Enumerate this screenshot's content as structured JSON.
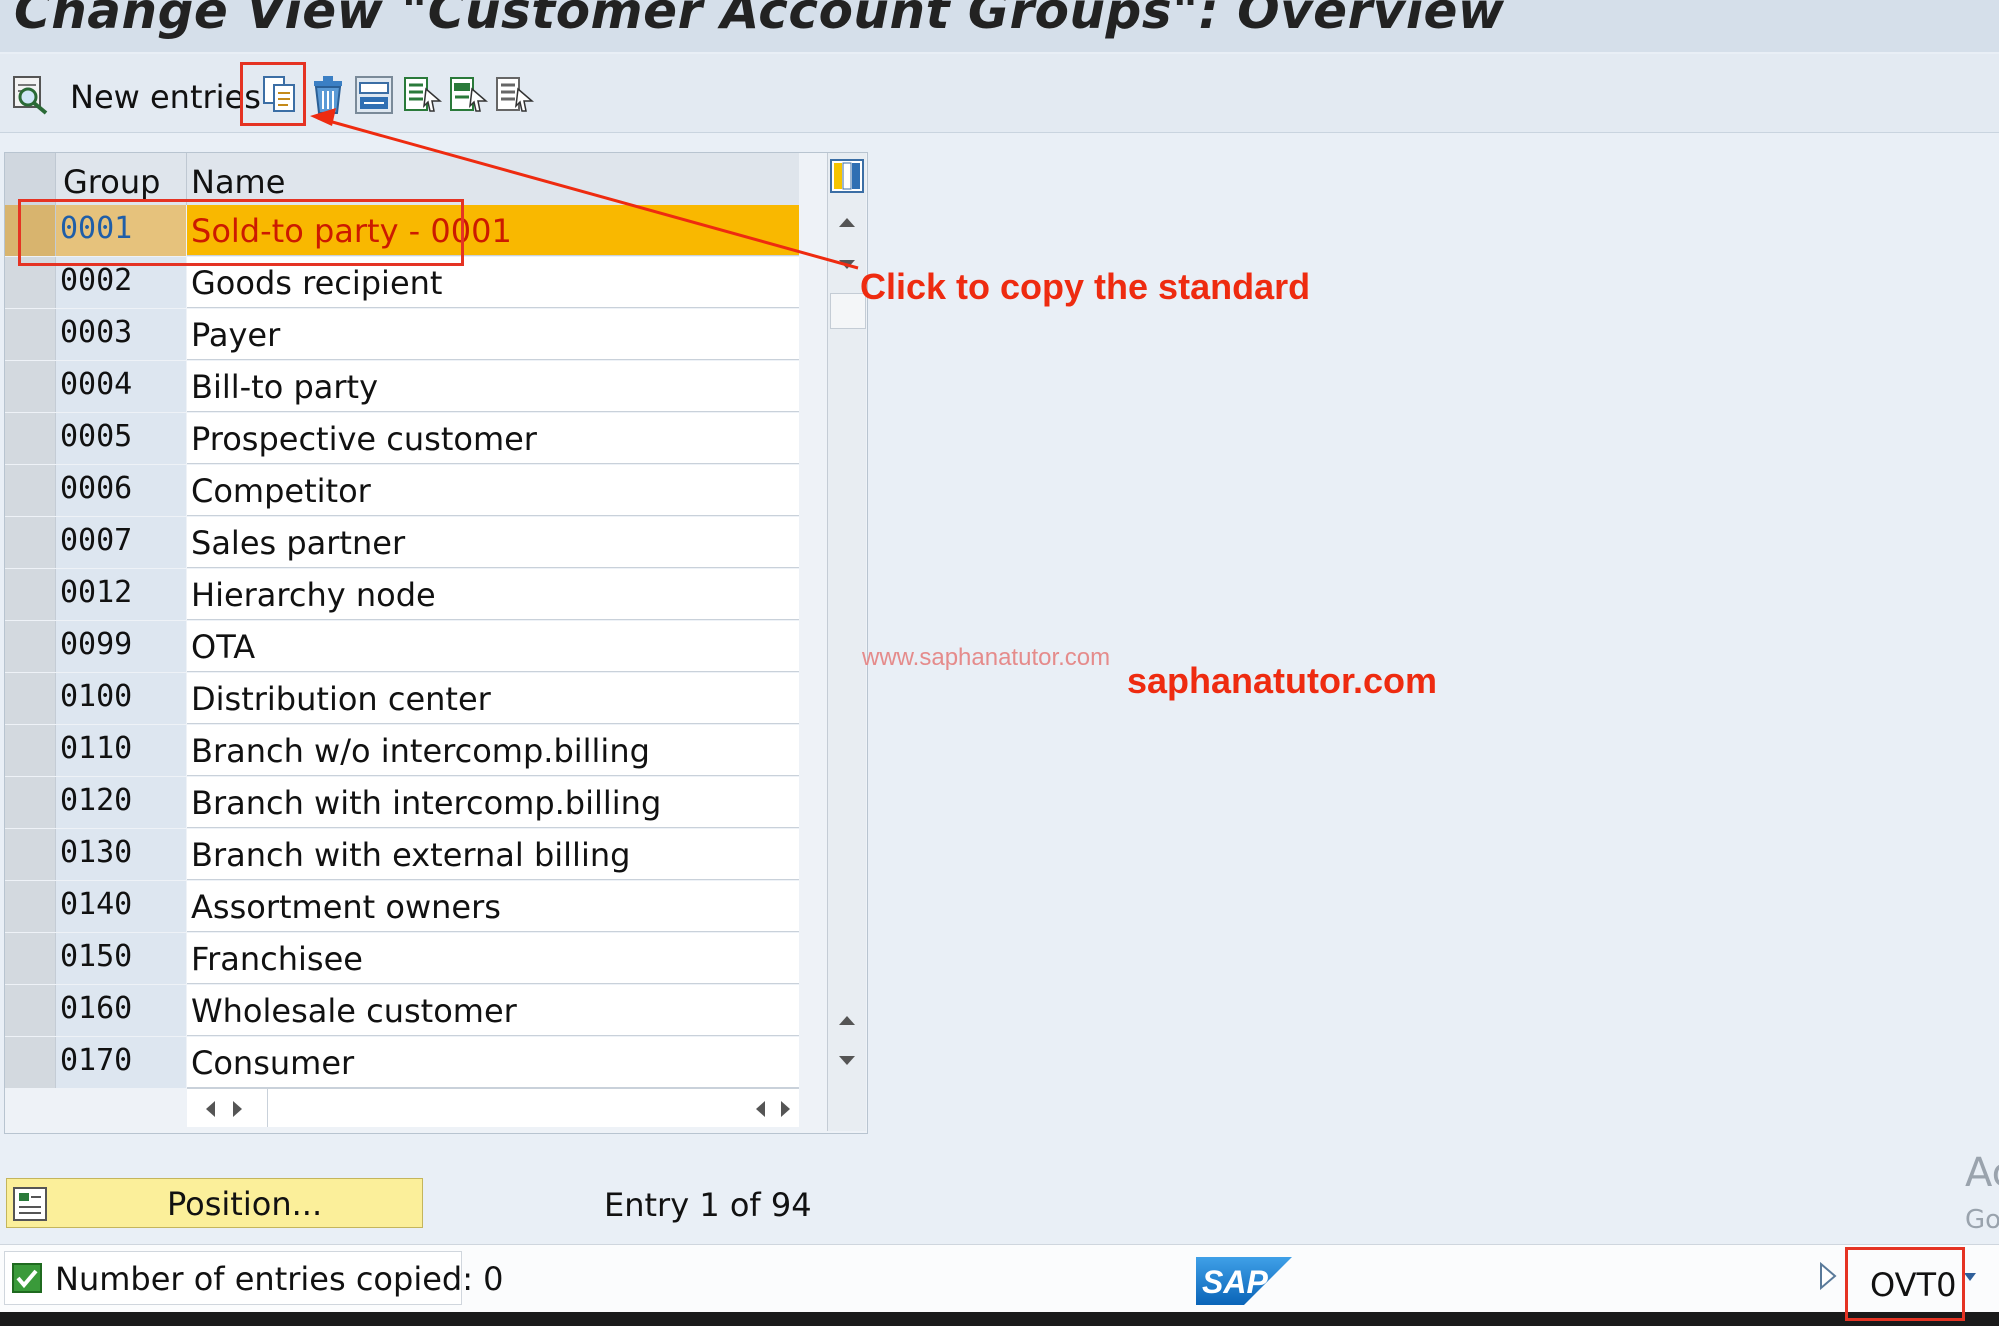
{
  "window": {
    "title": "Change View \"Customer Account Groups\": Overview"
  },
  "toolbar": {
    "display_change_icon": "glasses-search-icon",
    "new_entries_label": "New entries",
    "buttons": [
      "copy-as-icon",
      "delete-icon",
      "undo-change-icon",
      "select-all-icon",
      "select-block-icon",
      "deselect-all-icon"
    ]
  },
  "table": {
    "columns": [
      "Group",
      "Name"
    ],
    "selected_index": 0,
    "rows": [
      {
        "group": "0001",
        "name": "Sold-to party - 0001"
      },
      {
        "group": "0002",
        "name": "Goods recipient"
      },
      {
        "group": "0003",
        "name": "Payer"
      },
      {
        "group": "0004",
        "name": "Bill-to party"
      },
      {
        "group": "0005",
        "name": "Prospective customer"
      },
      {
        "group": "0006",
        "name": "Competitor"
      },
      {
        "group": "0007",
        "name": "Sales partner"
      },
      {
        "group": "0012",
        "name": "Hierarchy node"
      },
      {
        "group": "0099",
        "name": "OTA"
      },
      {
        "group": "0100",
        "name": "Distribution center"
      },
      {
        "group": "0110",
        "name": "Branch w/o intercomp.billing"
      },
      {
        "group": "0120",
        "name": "Branch with intercomp.billing"
      },
      {
        "group": "0130",
        "name": "Branch with external billing"
      },
      {
        "group": "0140",
        "name": "Assortment owners"
      },
      {
        "group": "0150",
        "name": "Franchisee"
      },
      {
        "group": "0160",
        "name": "Wholesale customer"
      },
      {
        "group": "0170",
        "name": "Consumer"
      }
    ]
  },
  "footer": {
    "position_label": "Position...",
    "entry_info": "Entry 1 of 94"
  },
  "status": {
    "message": "Number of entries copied: 0",
    "transaction_code": "OVT0",
    "logo": "SAP"
  },
  "annotations": {
    "callout": "Click to copy the standard",
    "site": "saphanatutor.com",
    "watermark": "www.saphanatutor.com",
    "accent_color": "#ee2b10"
  },
  "overlay": {
    "activate_fragment": "Ac",
    "go_fragment": "Go"
  }
}
